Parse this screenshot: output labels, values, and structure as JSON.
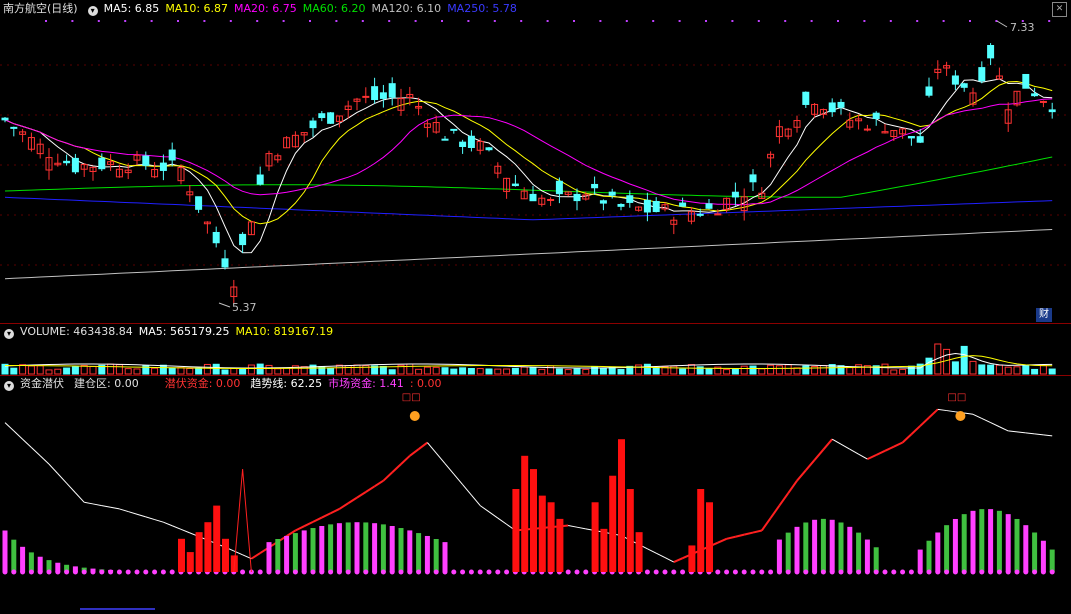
{
  "main": {
    "stock_name": "南方航空(日线)",
    "ma5": "MA5: 6.85",
    "ma10": "MA10: 6.87",
    "ma20": "MA20: 6.75",
    "ma60": "MA60: 6.20",
    "ma120": "MA120: 6.10",
    "ma250": "MA250: 5.78",
    "high_label": "7.33",
    "low_label": "5.37",
    "cai_badge": "财",
    "colors": {
      "up": "#ff3232",
      "down": "#54ffff",
      "ma5": "#ffffff",
      "ma10": "#ffff00",
      "ma20": "#ff00ff",
      "ma60": "#00e000",
      "ma120": "#c0c0c0",
      "ma250": "#2020ff"
    }
  },
  "volume": {
    "label": "VOLUME: 463438.84",
    "ma5": "MA5: 565179.25",
    "ma10": "MA10: 819167.19"
  },
  "indicator": {
    "name": "资金潜伏",
    "jiancang": "建仓区: 0.00",
    "qianfu": "潜伏资金: 0.00",
    "qushi": "趋势线: 62.25",
    "shichang": "市场资金: 1.41",
    "extra": ": 0.00",
    "marker_text": "□□"
  },
  "chart_data": [
    {
      "type": "candlestick",
      "title": "南方航空(日线)",
      "ylim": [
        5.2,
        7.5
      ],
      "high_annotation": 7.33,
      "low_annotation": 5.37,
      "series": [
        {
          "name": "MA5",
          "value": 6.85
        },
        {
          "name": "MA10",
          "value": 6.87
        },
        {
          "name": "MA20",
          "value": 6.75
        },
        {
          "name": "MA60",
          "value": 6.2
        },
        {
          "name": "MA120",
          "value": 6.1
        },
        {
          "name": "MA250",
          "value": 5.78
        }
      ]
    },
    {
      "type": "bar",
      "title": "VOLUME",
      "series": [
        {
          "name": "VOLUME",
          "value": 463438.84
        },
        {
          "name": "MA5",
          "value": 565179.25
        },
        {
          "name": "MA10",
          "value": 819167.19
        }
      ]
    },
    {
      "type": "line",
      "title": "资金潜伏",
      "ylim": [
        0,
        100
      ],
      "series": [
        {
          "name": "建仓区",
          "value": 0.0
        },
        {
          "name": "潜伏资金",
          "value": 0.0
        },
        {
          "name": "趋势线",
          "value": 62.25
        },
        {
          "name": "市场资金",
          "value": 1.41
        }
      ]
    }
  ]
}
